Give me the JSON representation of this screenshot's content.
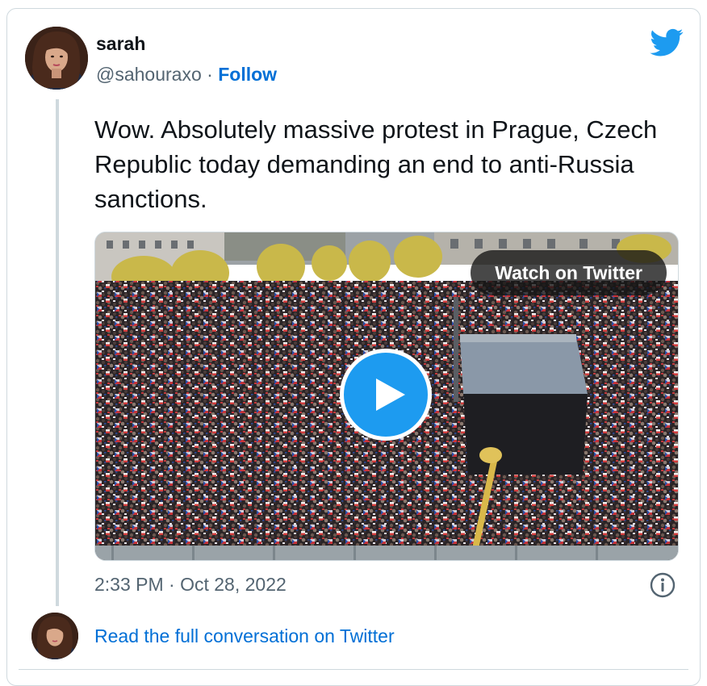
{
  "author": {
    "name": "sarah",
    "handle": "@sahouraxo",
    "separator": " · ",
    "follow_label": "Follow"
  },
  "tweet": {
    "text": "Wow. Absolutely massive protest in Prague, Czech Republic today demanding an end to anti-Russia sanctions."
  },
  "media": {
    "watch_label": "Watch on Twitter"
  },
  "footer": {
    "timestamp": "2:33 PM · Oct 28, 2022",
    "read_conversation_label": "Read the full conversation on Twitter"
  },
  "icons": {
    "brand": "twitter-bird-icon",
    "info": "info-icon",
    "play": "play-icon"
  },
  "colors": {
    "accent": "#1d9bf0",
    "link": "#006fd6",
    "text": "#0f1419",
    "muted": "#536471",
    "border": "#cfd9de"
  }
}
